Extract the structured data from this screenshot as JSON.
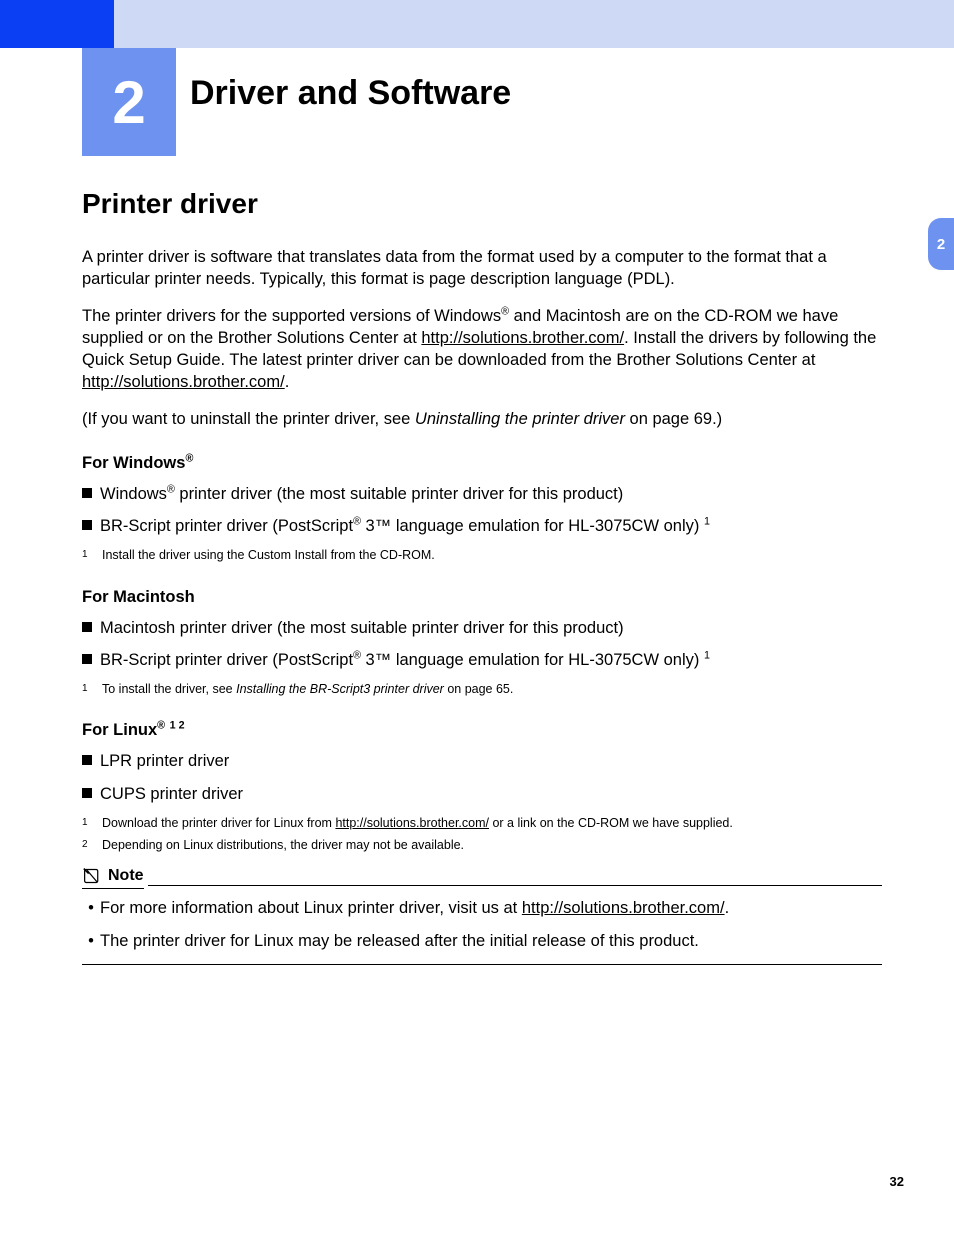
{
  "chapter": {
    "number": "2",
    "title": "Driver and Software"
  },
  "side_tab": "2",
  "sections": {
    "h2": "Printer driver",
    "p1": "A printer driver is software that translates data from the format used by a computer to the format that a particular printer needs. Typically, this format is page description language (PDL).",
    "p2_a": "The printer drivers for the supported versions of Windows",
    "p2_b": " and Macintosh are on the CD-ROM we have supplied or on the Brother Solutions Center at ",
    "p2_link1": "http://solutions.brother.com/",
    "p2_c": ". Install the drivers by following the Quick Setup Guide. The latest printer driver can be downloaded from the Brother Solutions Center at ",
    "p2_link2": "http://solutions.brother.com/",
    "p2_d": ".",
    "p3_a": "(If you want to uninstall the printer driver, see ",
    "p3_i": "Uninstalling the printer driver",
    "p3_b": " on page 69.)",
    "win": {
      "head_a": "For Windows",
      "b1_a": "Windows",
      "b1_b": " printer driver (the most suitable printer driver for this product)",
      "b2_a": "BR-Script printer driver (PostScript",
      "b2_b": " 3™ language emulation for HL-3075CW only) ",
      "fn1": "Install the driver using the Custom Install from the CD-ROM."
    },
    "mac": {
      "head": "For Macintosh",
      "b1": "Macintosh printer driver (the most suitable printer driver for this product)",
      "b2_a": "BR-Script printer driver (PostScript",
      "b2_b": " 3™ language emulation for HL-3075CW only) ",
      "fn1_a": "To install the driver, see ",
      "fn1_i": "Installing the BR-Script3 printer driver",
      "fn1_b": " on page 65."
    },
    "linux": {
      "head_a": "For Linux",
      "b1": "LPR printer driver",
      "b2": "CUPS printer driver",
      "fn1_a": "Download the printer driver for Linux from ",
      "fn1_link": "http://solutions.brother.com/",
      "fn1_b": " or a link on the CD-ROM we have supplied.",
      "fn2": "Depending on Linux distributions, the driver may not be available."
    },
    "note": {
      "title": "Note",
      "b1_a": "For more information about Linux printer driver, visit us at ",
      "b1_link": "http://solutions.brother.com/",
      "b1_b": ".",
      "b2": "The printer driver for Linux may be released after the initial release of this product."
    }
  },
  "page_number": "32",
  "glyphs": {
    "reg": "®",
    "fn1": "1",
    "fn2": "2",
    "fn12": "1 2",
    "dot": "•"
  }
}
